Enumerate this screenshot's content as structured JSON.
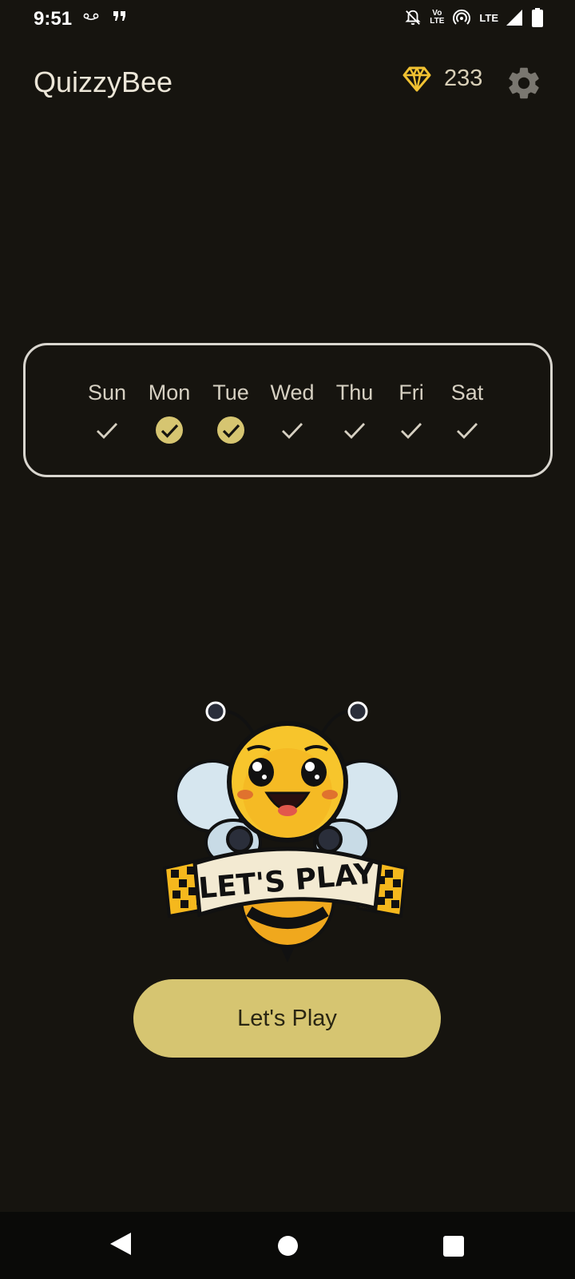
{
  "status_bar": {
    "time": "9:51",
    "left_icons": [
      "voicemail-icon",
      "quote-icon"
    ],
    "right_icons": [
      "bell-off-icon",
      "volte-icon",
      "hotspot-icon",
      "lte-signal-icon",
      "battery-icon"
    ],
    "volte_top": "Vo",
    "volte_bottom": "LTE",
    "network": "LTE"
  },
  "app_bar": {
    "title": "QuizzyBee",
    "gem_count": "233",
    "gem_icon": "diamond-icon",
    "settings_icon": "gear-icon"
  },
  "week": {
    "days": [
      {
        "label": "Sun",
        "completed": false
      },
      {
        "label": "Mon",
        "completed": true
      },
      {
        "label": "Tue",
        "completed": true
      },
      {
        "label": "Wed",
        "completed": false
      },
      {
        "label": "Thu",
        "completed": false
      },
      {
        "label": "Fri",
        "completed": false
      },
      {
        "label": "Sat",
        "completed": false
      }
    ]
  },
  "mascot": {
    "banner_text": "LET'S PLAY"
  },
  "play_button": {
    "label": "Let's Play"
  },
  "colors": {
    "background": "#16140f",
    "accent": "#d6c571",
    "gem": "#f1c232"
  },
  "nav_bar": {
    "icons": [
      "back-icon",
      "home-icon",
      "recents-icon"
    ]
  }
}
